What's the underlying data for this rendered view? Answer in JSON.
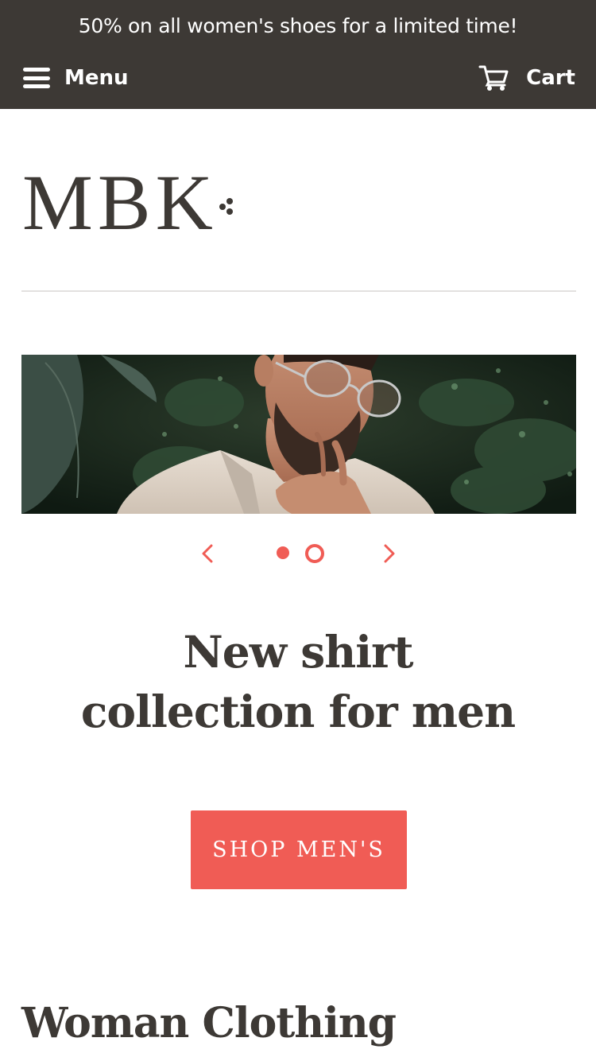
{
  "announcement": "50% on all women's shoes for a limited time!",
  "header": {
    "menu_label": "Menu",
    "cart_label": "Cart",
    "menu_icon": "hamburger-icon",
    "cart_icon": "cart-icon"
  },
  "logo": {
    "text": "MBK"
  },
  "slideshow": {
    "image_alt": "Man with glasses in front of green leaves",
    "prev_icon": "chevron-left-icon",
    "next_icon": "chevron-right-icon",
    "slide_count": 2,
    "active_slide": 1,
    "headline_line1": "New shirt",
    "headline_line2": "collection for men",
    "cta_label": "SHOP MEN'S"
  },
  "sections": {
    "woman_title": "Woman Clothing"
  },
  "colors": {
    "header_bg": "#3d3935",
    "accent": "#f05c55",
    "text": "#3d3935",
    "divider": "#e3e1df"
  }
}
